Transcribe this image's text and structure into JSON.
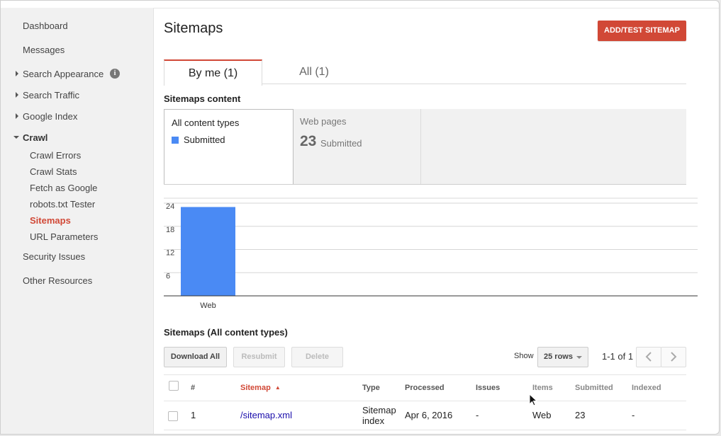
{
  "sidebar": {
    "items": [
      {
        "label": "Dashboard"
      },
      {
        "label": "Messages"
      },
      {
        "label": "Search Appearance"
      },
      {
        "label": "Search Traffic"
      },
      {
        "label": "Google Index"
      },
      {
        "label": "Crawl"
      },
      {
        "label": "Crawl Errors"
      },
      {
        "label": "Crawl Stats"
      },
      {
        "label": "Fetch as Google"
      },
      {
        "label": "robots.txt Tester"
      },
      {
        "label": "Sitemaps"
      },
      {
        "label": "URL Parameters"
      },
      {
        "label": "Security Issues"
      },
      {
        "label": "Other Resources"
      }
    ],
    "info_glyph": "i"
  },
  "header": {
    "title": "Sitemaps",
    "add_button": "ADD/TEST SITEMAP"
  },
  "tabs": [
    {
      "label": "By me (1)"
    },
    {
      "label": "All (1)"
    }
  ],
  "content": {
    "section_title": "Sitemaps content",
    "card_all": {
      "title": "All content types",
      "legend": "Submitted"
    },
    "card_web": {
      "title": "Web pages",
      "count": "23",
      "count_label": "Submitted"
    }
  },
  "chart_data": {
    "type": "bar",
    "categories": [
      "Web"
    ],
    "series": [
      {
        "name": "Submitted",
        "values": [
          23
        ]
      }
    ],
    "yticks": [
      6,
      12,
      18,
      24
    ],
    "ylim": [
      0,
      24
    ],
    "grid": true,
    "color": "#4a8af4"
  },
  "table": {
    "title": "Sitemaps (All content types)",
    "buttons": {
      "download": "Download All",
      "resubmit": "Resubmit",
      "delete": "Delete"
    },
    "show_label": "Show",
    "rows_select": "25 rows",
    "pagination": "1-1 of 1",
    "headers": [
      "#",
      "Sitemap",
      "Type",
      "Processed",
      "Issues",
      "Items",
      "Submitted",
      "Indexed"
    ],
    "sort_glyph": "▲",
    "rows": [
      {
        "num": "1",
        "sitemap": "/sitemap.xml",
        "type_line1": "Sitemap",
        "type_line2": "index",
        "processed": "Apr 6, 2016",
        "issues": "-",
        "items": "Web",
        "submitted": "23",
        "indexed": "-"
      }
    ]
  },
  "colors": {
    "accent": "#d14836",
    "link": "#1a0dab",
    "bar": "#4a8af4"
  }
}
